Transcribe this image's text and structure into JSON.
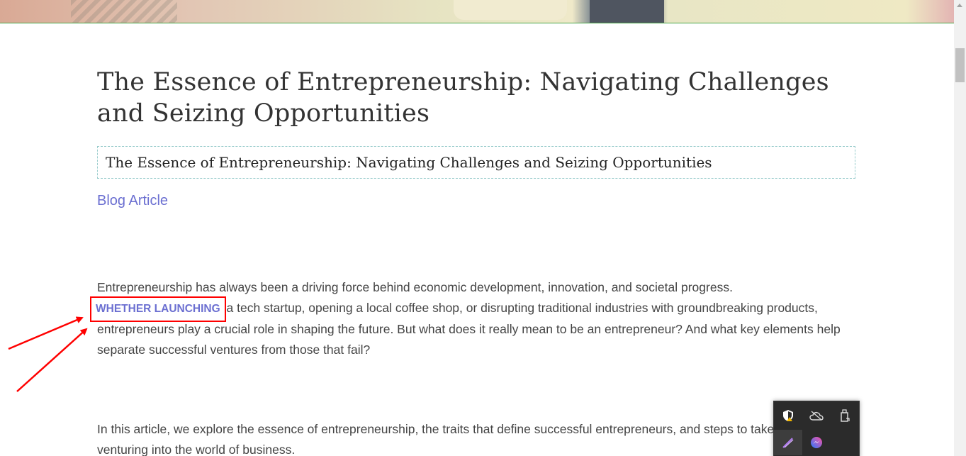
{
  "article": {
    "title": "The Essence of Entrepreneurship: Navigating Challenges and Seizing Opportunities",
    "subtitle": "The Essence of Entrepreneurship: Navigating Challenges and Seizing Opportunities",
    "category": "Blog Article",
    "paragraph1": {
      "intro": "Entrepreneurship has always been a driving force behind economic development, innovation, and societal progress. ",
      "highlighted": "WHETHER LAUNCHING",
      "rest": " a tech startup, opening a local coffee shop, or disrupting traditional industries with groundbreaking products, entrepreneurs play a crucial role in shaping the future. But what does it really mean to be an entrepreneur? And what key elements help separate successful ventures from those that fail?"
    },
    "paragraph2": "In this article, we explore the essence of entrepreneurship, the traits that define successful entrepreneurs, and steps to take when venturing into the world of business."
  },
  "tray": {
    "icons": [
      {
        "name": "security-shield-icon",
        "glyph": "⛨"
      },
      {
        "name": "onedrive-cloud-icon",
        "glyph": "☁"
      },
      {
        "name": "usb-device-icon",
        "glyph": "▯"
      },
      {
        "name": "pen-app-icon",
        "glyph": "✎"
      },
      {
        "name": "messenger-icon",
        "glyph": "◉"
      }
    ]
  },
  "colors": {
    "accent": "#6b6fd1",
    "annotation": "#ff0000"
  }
}
